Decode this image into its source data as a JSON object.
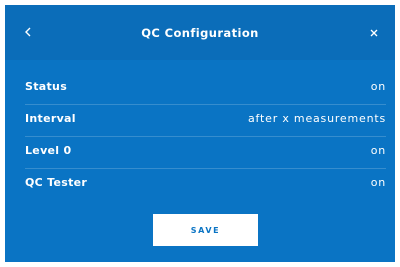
{
  "header": {
    "title": "QC Configuration",
    "back_icon": "chevron-left-icon",
    "close_icon": "close-icon"
  },
  "settings": [
    {
      "label": "Status",
      "value": "on"
    },
    {
      "label": "Interval",
      "value": "after x measurements"
    },
    {
      "label": "Level 0",
      "value": "on"
    },
    {
      "label": "QC Tester",
      "value": "on"
    }
  ],
  "actions": {
    "save_label": "SAVE"
  },
  "colors": {
    "panel_background": "#0a74c4",
    "header_background": "#0b6db9",
    "text": "#ffffff",
    "button_background": "#ffffff"
  }
}
